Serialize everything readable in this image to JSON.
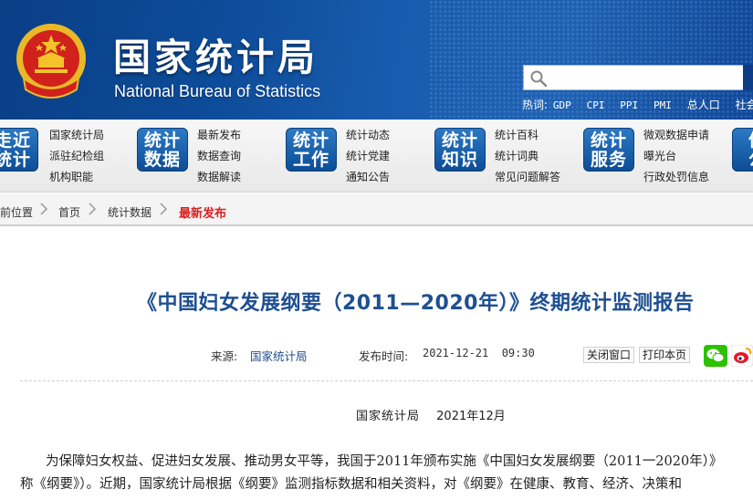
{
  "header": {
    "title_cn": "国家统计局",
    "title_en": "National Bureau of Statistics",
    "search": {
      "placeholder": "",
      "value": ""
    },
    "hotwords_label": "热词:",
    "hotwords": [
      "GDP",
      "CPI",
      "PPI",
      "PMI",
      "总人口",
      "社会"
    ]
  },
  "nav": {
    "groups": [
      {
        "badge": [
          "走近",
          "统计"
        ],
        "links": [
          "国家统计局",
          "派驻纪检组",
          "机构职能"
        ]
      },
      {
        "badge": [
          "统计",
          "数据"
        ],
        "links": [
          "最新发布",
          "数据查询",
          "数据解读"
        ]
      },
      {
        "badge": [
          "统计",
          "工作"
        ],
        "links": [
          "统计动态",
          "统计党建",
          "通知公告"
        ]
      },
      {
        "badge": [
          "统计",
          "知识"
        ],
        "links": [
          "统计百科",
          "统计词典",
          "常见问题解答"
        ]
      },
      {
        "badge": [
          "统计",
          "服务"
        ],
        "links": [
          "微观数据申请",
          "曝光台",
          "行政处罚信息"
        ]
      },
      {
        "badge": [
          "信",
          "公"
        ],
        "links": []
      }
    ]
  },
  "breadcrumb": {
    "items": [
      "前位置",
      "首页",
      "统计数据",
      "最新发布"
    ]
  },
  "article": {
    "title": "《中国妇女发展纲要（2011—2020年）》终期统计监测报告",
    "source_label": "来源:",
    "source": "国家统计局",
    "time_label": "发布时间:",
    "time": "2021-12-21  09:30",
    "close_label": "关闭窗口",
    "print_label": "打印本页",
    "publisher": "国家统计局",
    "date": "2021年12月",
    "paragraphs": [
      "为保障妇女权益、促进妇女发展、推动男女平等，我国于2011年颁布实施《中国妇女发展纲要（2011一2020年）》",
      "称《纲要》）。近期，国家统计局根据《纲要》监测指标数据和相关资料，对《纲要》在健康、教育、经济、决策和"
    ]
  },
  "colors": {
    "header_blue": "#0d4c9a",
    "title_blue": "#1e4f91",
    "breadcrumb_current": "#d82020",
    "nav_badge": "#1a63ad"
  }
}
